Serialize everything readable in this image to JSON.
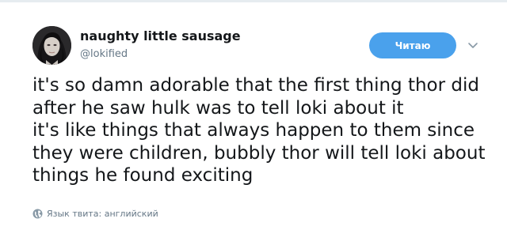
{
  "tweet": {
    "author": {
      "display_name": "naughty little sausage",
      "handle": "@lokified"
    },
    "follow_button_label": "Читаю",
    "text": "it's so damn adorable that the first thing thor did after he saw hulk was to tell loki about it\nit's like things that always happen to them since they were children, bubbly thor will tell loki about things he found exciting",
    "translate_label": "Язык твита: английский"
  },
  "colors": {
    "accent": "#4aa1ec",
    "secondary_text": "#657786",
    "primary_text": "#14171a"
  },
  "icons": {
    "avatar": "user-avatar-image",
    "caret": "chevron-down-icon",
    "globe": "globe-icon"
  }
}
